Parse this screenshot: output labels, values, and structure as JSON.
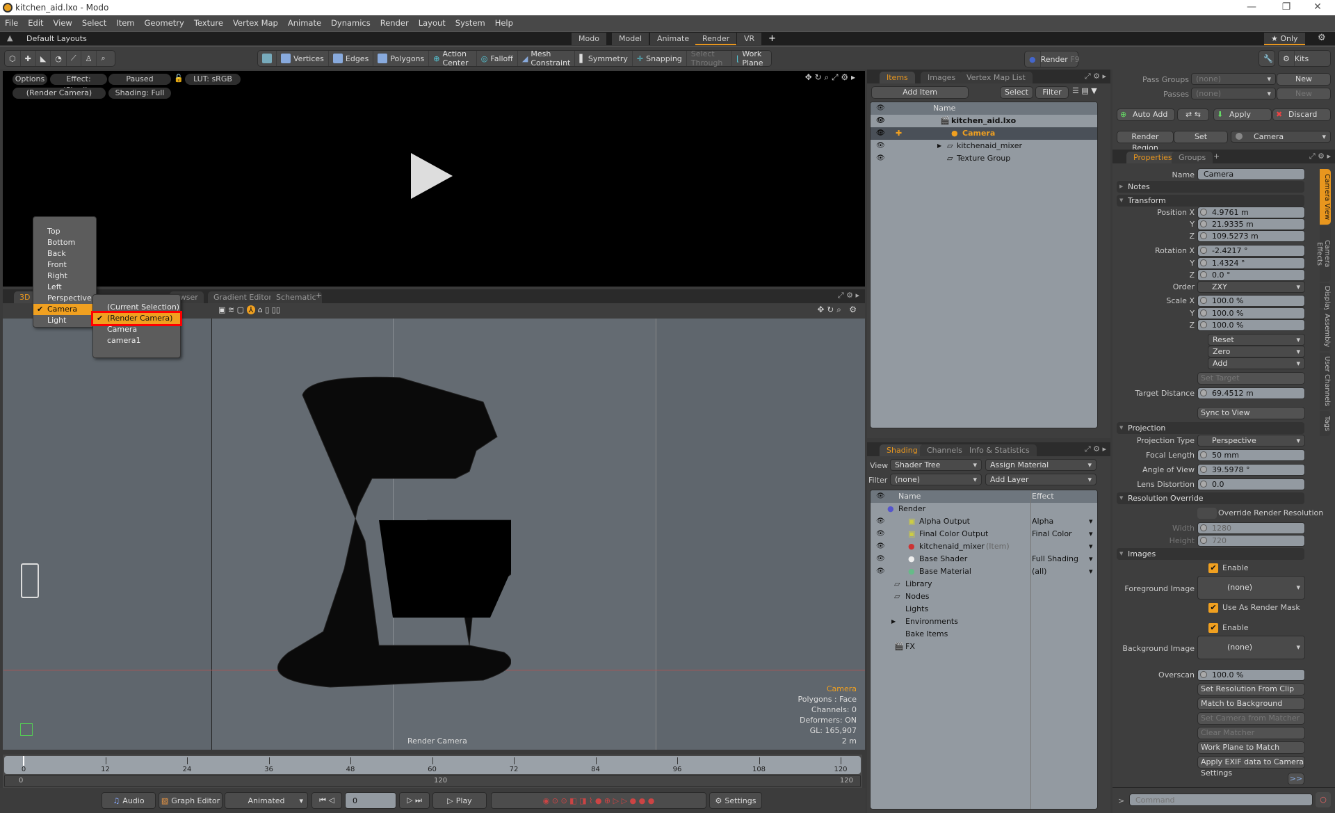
{
  "window": {
    "title": "kitchen_aid.lxo - Modo",
    "minimize": "—",
    "restore": "❐",
    "close": "✕"
  },
  "menubar": [
    "File",
    "Edit",
    "View",
    "Select",
    "Item",
    "Geometry",
    "Texture",
    "Vertex Map",
    "Animate",
    "Dynamics",
    "Render",
    "Layout",
    "System",
    "Help"
  ],
  "layouts": {
    "default_label": "Default Layouts",
    "tabs": [
      "Modo",
      "Model",
      "Animate",
      "Render",
      "VR"
    ],
    "active_tab": "Render",
    "add": "+",
    "only_label": "★ Only"
  },
  "toolbar": {
    "vertices": "Vertices",
    "edges": "Edges",
    "polygons": "Polygons",
    "action_center": "Action Center",
    "falloff": "Falloff",
    "mesh_constraint": "Mesh Constraint",
    "symmetry": "Symmetry",
    "snapping": "Snapping",
    "select_through": "Select Through",
    "work_plane": "Work Plane",
    "render": "Render",
    "render_shortcut": "F9",
    "kits": "Kits"
  },
  "render_view": {
    "options": "Options",
    "effect": "Effect: (Shadi...",
    "status": "Paused",
    "lut": "LUT: sRGB",
    "camera": "(Render Camera)",
    "shading": "Shading: Full"
  },
  "viewport_tabs": [
    "3D V",
    "owser",
    "Gradient Editor",
    "Schematic"
  ],
  "viewport_tabs_add": "+",
  "view_menu": {
    "items": [
      "Top",
      "Bottom",
      "Back",
      "Front",
      "Right",
      "Left",
      "Perspective",
      "Camera",
      "Light"
    ],
    "selected": "Camera"
  },
  "camera_submenu": {
    "items": [
      "(Current Selection)",
      "(Render Camera)",
      "Camera",
      "camera1"
    ],
    "selected": "(Render Camera)",
    "checkmark": "✔"
  },
  "viewport_info": {
    "item": "Camera",
    "polygons": "Polygons : Face",
    "channels": "Channels: 0",
    "deformers": "Deformers: ON",
    "gl": "GL: 165,907",
    "scale": "2 m",
    "camera_label": "Render Camera"
  },
  "timeline": {
    "ticks": [
      "0",
      "12",
      "24",
      "36",
      "48",
      "60",
      "72",
      "84",
      "96",
      "108",
      "120"
    ],
    "range_start": "0",
    "range_mid": "120",
    "range_end": "120"
  },
  "transport": {
    "audio": "Audio",
    "graph_editor": "Graph Editor",
    "mode": "Animated",
    "frame": "0",
    "play": "Play",
    "settings": "Settings"
  },
  "items_panel": {
    "tabs": [
      "Items",
      "Images",
      "Vertex Map List"
    ],
    "active_tab": "Items",
    "add_item": "Add Item",
    "select": "Select",
    "filter": "Filter",
    "column_name": "Name",
    "rows": [
      {
        "name": "kitchen_aid.lxo",
        "bold": true
      },
      {
        "name": "Camera",
        "selected": true
      },
      {
        "name": "kitchenaid_mixer"
      },
      {
        "name": "Texture Group"
      }
    ]
  },
  "shading_panel": {
    "tabs": [
      "Shading",
      "Channels",
      "Info & Statistics"
    ],
    "active_tab": "Shading",
    "view_label": "View",
    "view_value": "Shader Tree",
    "assign_material": "Assign Material",
    "filter_label": "Filter",
    "filter_value": "(none)",
    "add_layer": "Add Layer",
    "col_name": "Name",
    "col_effect": "Effect",
    "rows": [
      {
        "name": "Render",
        "effect": ""
      },
      {
        "name": "Alpha Output",
        "effect": "Alpha"
      },
      {
        "name": "Final Color Output",
        "effect": "Final Color"
      },
      {
        "name": "kitchenaid_mixer",
        "suffix": "(Item)",
        "effect": ""
      },
      {
        "name": "Base Shader",
        "effect": "Full Shading"
      },
      {
        "name": "Base Material",
        "effect": "(all)"
      },
      {
        "name": "Library",
        "effect": ""
      },
      {
        "name": "Nodes",
        "effect": ""
      },
      {
        "name": "Lights",
        "effect": ""
      },
      {
        "name": "Environments",
        "effect": ""
      },
      {
        "name": "Bake Items",
        "effect": ""
      },
      {
        "name": "FX",
        "effect": ""
      }
    ]
  },
  "pass_panel": {
    "pass_groups_label": "Pass Groups",
    "pass_groups_value": "(none)",
    "passes_label": "Passes",
    "passes_value": "(none)",
    "new": "New",
    "auto_add": "Auto Add",
    "apply": "Apply",
    "discard": "Discard",
    "render_region": "Render Region",
    "set": "Set",
    "camera": "Camera"
  },
  "properties": {
    "tabs": [
      "Properties",
      "Groups"
    ],
    "active_tab": "Properties",
    "side_tabs": [
      "Camera View",
      "Camera Effects",
      "Display",
      "Assembly",
      "User Channels",
      "Tags"
    ],
    "name_label": "Name",
    "name_value": "Camera",
    "notes": "Notes",
    "transform": "Transform",
    "position": {
      "label": "Position X",
      "x": "4.9761 m",
      "y": "21.9335 m",
      "z": "109.5273 m"
    },
    "rotation": {
      "label": "Rotation X",
      "x": "-2.4217 °",
      "y": "1.4324 °",
      "z": "0.0 °"
    },
    "order_label": "Order",
    "order_value": "ZXY",
    "scale": {
      "label": "Scale X",
      "x": "100.0 %",
      "y": "100.0 %",
      "z": "100.0 %"
    },
    "reset": "Reset",
    "zero": "Zero",
    "add": "Add",
    "set_target": "Set Target",
    "target_distance_label": "Target Distance",
    "target_distance": "69.4512 m",
    "sync_to_view": "Sync to View",
    "projection": "Projection",
    "projection_type_label": "Projection Type",
    "projection_type": "Perspective",
    "focal_length_label": "Focal Length",
    "focal_length": "50 mm",
    "angle_of_view_label": "Angle of View",
    "angle_of_view": "39.5978 °",
    "lens_distortion_label": "Lens Distortion",
    "lens_distortion": "0.0",
    "resolution_override": "Resolution Override",
    "override_render_resolution": "Override Render Resolution",
    "width_label": "Width",
    "width": "1280",
    "height_label": "Height",
    "height": "720",
    "images": "Images",
    "enable": "Enable",
    "foreground_image_label": "Foreground Image",
    "foreground_image": "(none)",
    "use_as_render_mask": "Use As Render Mask",
    "background_image_label": "Background Image",
    "background_image": "(none)",
    "overscan_label": "Overscan",
    "overscan": "100.0 %",
    "buttons": [
      "Set Resolution From Clip",
      "Match to Background",
      "Set Camera from Matcher",
      "Clear Matcher",
      "Work Plane to Match",
      "Apply EXIF data to Camera Settings"
    ],
    "more": ">>",
    "command_placeholder": "Command"
  }
}
